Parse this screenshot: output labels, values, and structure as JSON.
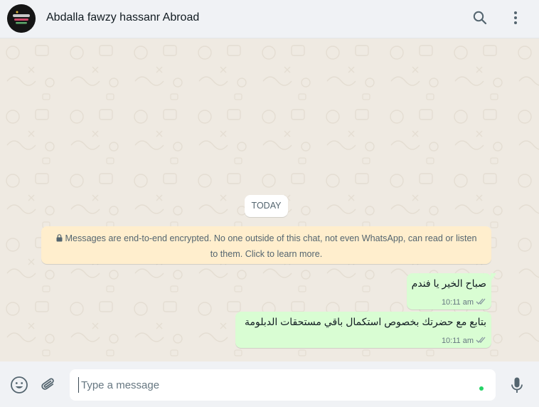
{
  "header": {
    "contact_name": "Abdalla fawzy hassanr Abroad",
    "search_icon": "search-icon",
    "menu_icon": "more-vertical-icon"
  },
  "chat": {
    "date_chip": "TODAY",
    "encryption_notice": "Messages are end-to-end encrypted. No one outside of this chat, not even WhatsApp, can read or listen to them. Click to learn more.",
    "messages": [
      {
        "text": "صباح الخير يا فندم",
        "time": "10:11 am",
        "status": "read-double-check"
      },
      {
        "text": "بتابع مع حضرتك بخصوص استكمال باقي مستحقات الدبلومة",
        "time": "10:11 am",
        "status": "read-double-check"
      }
    ]
  },
  "composer": {
    "placeholder": "Type a message",
    "value": "",
    "emoji_icon": "emoji-icon",
    "attach_icon": "paperclip-icon",
    "mic_icon": "microphone-icon"
  },
  "colors": {
    "outgoing_bubble": "#d9fdd3",
    "notice_bg": "#ffeecd",
    "chat_bg": "#efeae2",
    "header_bg": "#f0f2f5",
    "online_dot": "#25d366"
  }
}
